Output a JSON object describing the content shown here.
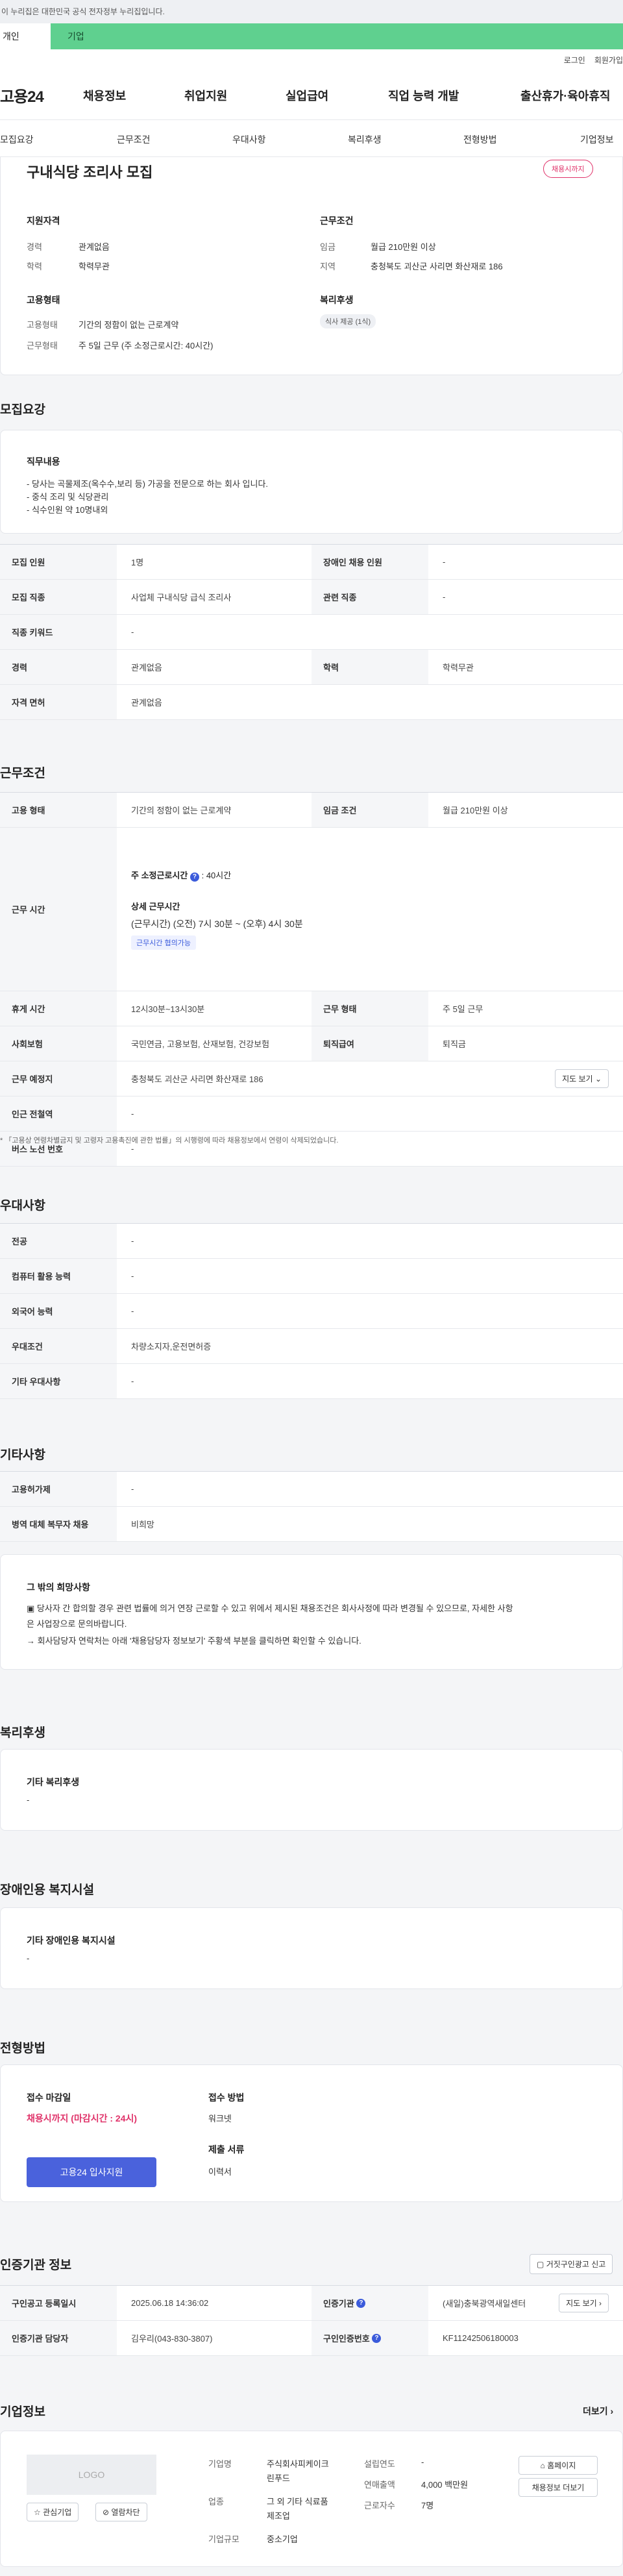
{
  "notice": "이 누리집은 대한민국 공식 전자정부 누리집입니다.",
  "tabs": {
    "personal": "개인",
    "company": "기업"
  },
  "util": {
    "login": "로그인",
    "join": "회원가입"
  },
  "logo": "고용24",
  "gnb": [
    "채용정보",
    "취업지원",
    "실업급여",
    "직업 능력 개발",
    "출산휴가·육아휴직"
  ],
  "lnb": [
    "모집요강",
    "근무조건",
    "우대사항",
    "복리후생",
    "전형방법",
    "기업정보"
  ],
  "summary": {
    "title": "구내식당 조리사 모집",
    "status_badge": "채용시까지",
    "support_title": "지원자격",
    "career_label": "경력",
    "career_value": "관계없음",
    "education_label": "학력",
    "education_value": "학력무관",
    "work_title": "근무조건",
    "wage_label": "임금",
    "wage_value": "월급 210만원 이상",
    "region_label": "지역",
    "region_value": "충청북도 괴산군 사리면 화산재로 186",
    "employ_title": "고용형태",
    "employ_type_label": "고용형태",
    "employ_type_value": "기간의 정함이 없는 근로계약",
    "work_form_label": "근무형태",
    "work_form_value": "주 5일 근무 (주 소정근로시간: 40시간)",
    "welfare_title": "복리후생",
    "welfare_chip": "식사 제공 (1식)"
  },
  "recruit": {
    "title": "모집요강",
    "duty_title": "직무내용",
    "duty_lines": [
      "- 당사는 곡물제조(옥수수,보리 등) 가공을 전문으로 하는 회사 입니다.",
      "- 중식 조리 및 식당관리",
      "- 식수인원 약 10명내외"
    ],
    "rows": [
      {
        "k1": "모집 인원",
        "v1": "1명",
        "k2": "장애인 채용 인원",
        "v2": "-"
      },
      {
        "k1": "모집 직종",
        "v1": "사업체 구내식당 급식 조리사",
        "k2": "관련 직종",
        "v2": "-"
      },
      {
        "k1": "직종 키워드",
        "v1": "-"
      },
      {
        "k1": "경력",
        "v1": "관계없음",
        "k2": "학력",
        "v2": "학력무관"
      },
      {
        "k1": "자격 면허",
        "v1": "관계없음"
      }
    ]
  },
  "conditions": {
    "title": "근무조건",
    "employ_k": "고용 형태",
    "employ_v": "기간의 정함이 없는 근로계약",
    "wage_k": "임금 조건",
    "wage_v": "월급 210만원 이상",
    "hours_k": "근무 시간",
    "weekly_label": "주 소정근로시간",
    "weekly_value": ": 40시간",
    "detail_label": "상세 근무시간",
    "detail_value": "(근무시간) (오전) 7시 30분 ~ (오후) 4시 30분",
    "hours_chip": "근무시간 협의가능",
    "break_k": "휴게 시간",
    "break_v": "12시30분~13시30분",
    "form_k": "근무 형태",
    "form_v": "주 5일 근무",
    "insurance_k": "사회보험",
    "insurance_v": "국민연금, 고용보험, 산재보험, 건강보험",
    "severance_k": "퇴직급여",
    "severance_v": "퇴직금",
    "place_k": "근무 예정지",
    "place_v": "충청북도 괴산군 사리면 화산재로 186",
    "map_btn": "지도 보기",
    "subway_k": "인근 전철역",
    "subway_v": "-",
    "bus_k": "버스 노선 번호",
    "bus_v": "-",
    "footnote": "「고용상 연령차별금지 및 고령자 고용촉진에 관한 법률」의 시행령에 따라 채용정보에서 연령이 삭제되었습니다."
  },
  "preference": {
    "title": "우대사항",
    "rows": [
      {
        "k": "전공",
        "v": "-"
      },
      {
        "k": "컴퓨터 활용 능력",
        "v": "-"
      },
      {
        "k": "외국어 능력",
        "v": "-"
      },
      {
        "k": "우대조건",
        "v": "차량소지자,운전면허증"
      },
      {
        "k": "기타 우대사항",
        "v": "-"
      }
    ]
  },
  "etc": {
    "title": "기타사항",
    "rows": [
      {
        "k": "고용허가제",
        "v": "-"
      },
      {
        "k": "병역 대체 복무자 채용",
        "v": "비희망"
      }
    ],
    "box_title": "그 밖의 희망사항",
    "box_line1": "▣ 당사자 간 합의할 경우 관련 법률에 의거 연장 근로할 수 있고 위에서 제시된 채용조건은 회사사정에 따라 변경될 수 있으므로, 자세한 사항",
    "box_line2": "은 사업장으로 문의바랍니다.",
    "box_line3": "→ 회사담당자 연락처는 아래 '채용담당자 정보보기' 주황색 부분을 클릭하면 확인할 수 있습니다."
  },
  "welfare": {
    "title": "복리후생",
    "sub": "기타 복리후생",
    "value": "-"
  },
  "disability": {
    "title": "장애인용 복지시설",
    "sub": "기타 장애인용 복지시설",
    "value": "-"
  },
  "selection": {
    "title": "전형방법",
    "deadline_label": "접수 마감일",
    "deadline_value": "채용시까지 (마감시간 : 24시)",
    "apply_btn": "고용24 입사지원",
    "method_label": "접수 방법",
    "method_value": "워크넷",
    "docs_label": "제출 서류",
    "docs_value": "이력서"
  },
  "agency": {
    "title": "인증기관 정보",
    "report_btn": "거짓구인광고 신고",
    "reg_k": "구인공고 등록일시",
    "reg_v": "2025.06.18 14:36:02",
    "org_k": "인증기관",
    "org_v": "(새일)충북광역새일센터",
    "map_btn": "지도 보기",
    "manager_k": "인증기관 담당자",
    "manager_v": "김우리(043-830-3807)",
    "auth_k": "구인인증번호",
    "auth_v": "KF11242506180003"
  },
  "company": {
    "title": "기업정보",
    "more": "더보기",
    "logo_text": "LOGO",
    "fav_btn": "관심기업",
    "block_btn": "열람차단",
    "name_k": "기업명",
    "name_v1": "주식회사피케이크",
    "name_v2": "린푸드",
    "industry_k": "업종",
    "industry_v1": "그 외 기타 식료품",
    "industry_v2": "제조업",
    "size_k": "기업규모",
    "size_v": "중소기업",
    "founded_k": "설립연도",
    "founded_v": "-",
    "sales_k": "연매출액",
    "sales_v": "4,000 백만원",
    "staff_k": "근로자수",
    "staff_v": "7명",
    "home_btn": "홈페이지",
    "more_btn": "채용정보 더보기"
  }
}
